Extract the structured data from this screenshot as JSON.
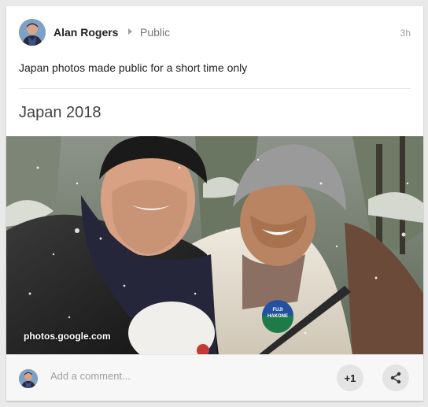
{
  "post": {
    "author": "Alan Rogers",
    "audience": "Public",
    "time": "3h",
    "text": "Japan photos made public for a short time only",
    "album_title": "Japan 2018",
    "photo_caption": "photos.google.com",
    "badge_line1": "FUJI",
    "badge_line2": "HAKONE"
  },
  "footer": {
    "comment_placeholder": "Add a comment...",
    "plus_one_label": "+1"
  },
  "icons": {
    "share": "share-icon",
    "caret": "caret-right-icon"
  },
  "colors": {
    "card_bg": "#ffffff",
    "page_bg": "#e9e9e9",
    "muted": "#757575"
  }
}
